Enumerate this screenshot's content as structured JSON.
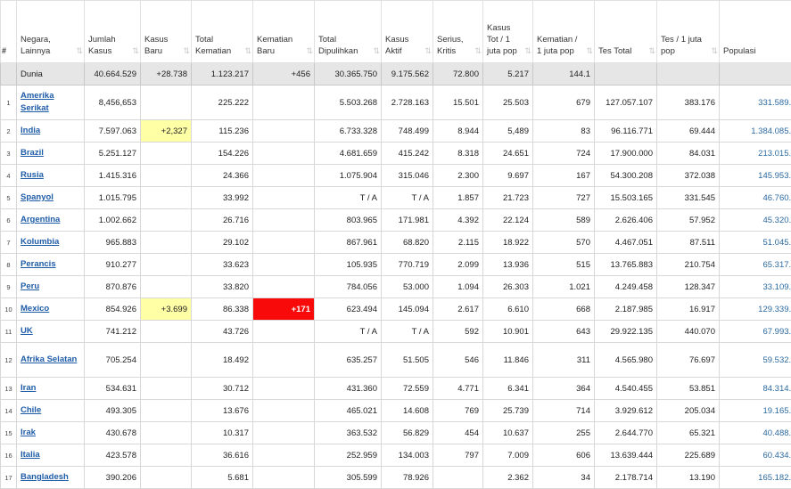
{
  "headers": [
    {
      "key": "num",
      "label": "#"
    },
    {
      "key": "country",
      "label": "Negara, Lainnya"
    },
    {
      "key": "total_cases",
      "label": "Jumlah Kasus"
    },
    {
      "key": "new_cases",
      "label": "Kasus Baru"
    },
    {
      "key": "total_deaths",
      "label": "Total Kematian"
    },
    {
      "key": "new_deaths",
      "label": "Kematian Baru"
    },
    {
      "key": "total_recovered",
      "label": "Total Dipulihkan"
    },
    {
      "key": "active",
      "label": "Kasus Aktif"
    },
    {
      "key": "serious",
      "label": "Serius, Kritis"
    },
    {
      "key": "cases_per_m",
      "label": "Kasus Tot / 1 juta pop"
    },
    {
      "key": "deaths_per_m",
      "label": "Kematian / 1 juta pop"
    },
    {
      "key": "total_tests",
      "label": "Tes Total"
    },
    {
      "key": "tests_per_m",
      "label": "Tes / 1 juta pop"
    },
    {
      "key": "population",
      "label": "Populasi"
    }
  ],
  "sort_icon": "⇅",
  "world": {
    "country": "Dunia",
    "total_cases": "40.664.529",
    "new_cases": "+28.738",
    "total_deaths": "1.123.217",
    "new_deaths": "+456",
    "total_recovered": "30.365.750",
    "active": "9.175.562",
    "serious": "72.800",
    "cases_per_m": "5.217",
    "deaths_per_m": "144.1",
    "total_tests": "",
    "tests_per_m": "",
    "population": ""
  },
  "rows": [
    {
      "num": "1",
      "country": "Amerika Serikat",
      "total_cases": "8,456,653",
      "new_cases": "",
      "total_deaths": "225.222",
      "new_deaths": "",
      "total_recovered": "5.503.268",
      "active": "2.728.163",
      "serious": "15.501",
      "cases_per_m": "25.503",
      "deaths_per_m": "679",
      "total_tests": "127.057.107",
      "tests_per_m": "383.176",
      "population": "331.589.837"
    },
    {
      "num": "2",
      "country": "India",
      "total_cases": "7.597.063",
      "new_cases": "+2,327",
      "total_deaths": "115.236",
      "new_deaths": "",
      "total_recovered": "6.733.328",
      "active": "748.499",
      "serious": "8.944",
      "cases_per_m": "5,489",
      "deaths_per_m": "83",
      "total_tests": "96.116.771",
      "tests_per_m": "69.444",
      "population": "1.384.085.979"
    },
    {
      "num": "3",
      "country": "Brazil",
      "total_cases": "5.251.127",
      "new_cases": "",
      "total_deaths": "154.226",
      "new_deaths": "",
      "total_recovered": "4.681.659",
      "active": "415.242",
      "serious": "8.318",
      "cases_per_m": "24.651",
      "deaths_per_m": "724",
      "total_tests": "17.900.000",
      "tests_per_m": "84.031",
      "population": "213.015.720"
    },
    {
      "num": "4",
      "country": "Rusia",
      "total_cases": "1.415.316",
      "new_cases": "",
      "total_deaths": "24.366",
      "new_deaths": "",
      "total_recovered": "1.075.904",
      "active": "315.046",
      "serious": "2.300",
      "cases_per_m": "9.697",
      "deaths_per_m": "167",
      "total_tests": "54.300.208",
      "tests_per_m": "372.038",
      "population": "145.953.533"
    },
    {
      "num": "5",
      "country": "Spanyol",
      "total_cases": "1.015.795",
      "new_cases": "",
      "total_deaths": "33.992",
      "new_deaths": "",
      "total_recovered": "T / A",
      "active": "T / A",
      "serious": "1.857",
      "cases_per_m": "21.723",
      "deaths_per_m": "727",
      "total_tests": "15.503.165",
      "tests_per_m": "331.545",
      "population": "46.760.297"
    },
    {
      "num": "6",
      "country": "Argentina",
      "total_cases": "1.002.662",
      "new_cases": "",
      "total_deaths": "26.716",
      "new_deaths": "",
      "total_recovered": "803.965",
      "active": "171.981",
      "serious": "4.392",
      "cases_per_m": "22.124",
      "deaths_per_m": "589",
      "total_tests": "2.626.406",
      "tests_per_m": "57.952",
      "population": "45.320.654"
    },
    {
      "num": "7",
      "country": "Kolumbia",
      "total_cases": "965.883",
      "new_cases": "",
      "total_deaths": "29.102",
      "new_deaths": "",
      "total_recovered": "867.961",
      "active": "68.820",
      "serious": "2.115",
      "cases_per_m": "18.922",
      "deaths_per_m": "570",
      "total_tests": "4.467.051",
      "tests_per_m": "87.511",
      "population": "51.045.852"
    },
    {
      "num": "8",
      "country": "Perancis",
      "total_cases": "910.277",
      "new_cases": "",
      "total_deaths": "33.623",
      "new_deaths": "",
      "total_recovered": "105.935",
      "active": "770.719",
      "serious": "2.099",
      "cases_per_m": "13.936",
      "deaths_per_m": "515",
      "total_tests": "13.765.883",
      "tests_per_m": "210.754",
      "population": "65.317.424"
    },
    {
      "num": "9",
      "country": "Peru",
      "total_cases": "870.876",
      "new_cases": "",
      "total_deaths": "33.820",
      "new_deaths": "",
      "total_recovered": "784.056",
      "active": "53.000",
      "serious": "1.094",
      "cases_per_m": "26.303",
      "deaths_per_m": "1.021",
      "total_tests": "4.249.458",
      "tests_per_m": "128.347",
      "population": "33.109.207"
    },
    {
      "num": "10",
      "country": "Mexico",
      "total_cases": "854.926",
      "new_cases": "+3.699",
      "total_deaths": "86.338",
      "new_deaths": "+171",
      "total_recovered": "623.494",
      "active": "145.094",
      "serious": "2.617",
      "cases_per_m": "6.610",
      "deaths_per_m": "668",
      "total_tests": "2.187.985",
      "tests_per_m": "16.917",
      "population": "129.339.873"
    },
    {
      "num": "11",
      "country": "UK",
      "total_cases": "741.212",
      "new_cases": "",
      "total_deaths": "43.726",
      "new_deaths": "",
      "total_recovered": "T / A",
      "active": "T / A",
      "serious": "592",
      "cases_per_m": "10.901",
      "deaths_per_m": "643",
      "total_tests": "29.922.135",
      "tests_per_m": "440.070",
      "population": "67.993.982"
    },
    {
      "num": "12",
      "country": "Afrika Selatan",
      "total_cases": "705.254",
      "new_cases": "",
      "total_deaths": "18.492",
      "new_deaths": "",
      "total_recovered": "635.257",
      "active": "51.505",
      "serious": "546",
      "cases_per_m": "11.846",
      "deaths_per_m": "311",
      "total_tests": "4.565.980",
      "tests_per_m": "76.697",
      "population": "59.532.742"
    },
    {
      "num": "13",
      "country": "Iran",
      "total_cases": "534.631",
      "new_cases": "",
      "total_deaths": "30.712",
      "new_deaths": "",
      "total_recovered": "431.360",
      "active": "72.559",
      "serious": "4.771",
      "cases_per_m": "6.341",
      "deaths_per_m": "364",
      "total_tests": "4.540.455",
      "tests_per_m": "53.851",
      "population": "84.314.980"
    },
    {
      "num": "14",
      "country": "Chile",
      "total_cases": "493.305",
      "new_cases": "",
      "total_deaths": "13.676",
      "new_deaths": "",
      "total_recovered": "465.021",
      "active": "14.608",
      "serious": "769",
      "cases_per_m": "25.739",
      "deaths_per_m": "714",
      "total_tests": "3.929.612",
      "tests_per_m": "205.034",
      "population": "19.165.653"
    },
    {
      "num": "15",
      "country": "Irak",
      "total_cases": "430.678",
      "new_cases": "",
      "total_deaths": "10.317",
      "new_deaths": "",
      "total_recovered": "363.532",
      "active": "56.829",
      "serious": "454",
      "cases_per_m": "10.637",
      "deaths_per_m": "255",
      "total_tests": "2.644.770",
      "tests_per_m": "65.321",
      "population": "40.488.958"
    },
    {
      "num": "16",
      "country": "Italia",
      "total_cases": "423.578",
      "new_cases": "",
      "total_deaths": "36.616",
      "new_deaths": "",
      "total_recovered": "252.959",
      "active": "134.003",
      "serious": "797",
      "cases_per_m": "7.009",
      "deaths_per_m": "606",
      "total_tests": "13.639.444",
      "tests_per_m": "225.689",
      "population": "60.434.663"
    },
    {
      "num": "17",
      "country": "Bangladesh",
      "total_cases": "390.206",
      "new_cases": "",
      "total_deaths": "5.681",
      "new_deaths": "",
      "total_recovered": "305.599",
      "active": "78.926",
      "serious": "",
      "cases_per_m": "2.362",
      "deaths_per_m": "34",
      "total_tests": "2.178.714",
      "tests_per_m": "13.190",
      "population": "165.182.885"
    }
  ],
  "highlights": {
    "new_cases_color": "#ffffa6",
    "new_deaths_color": "#f80a0a"
  }
}
